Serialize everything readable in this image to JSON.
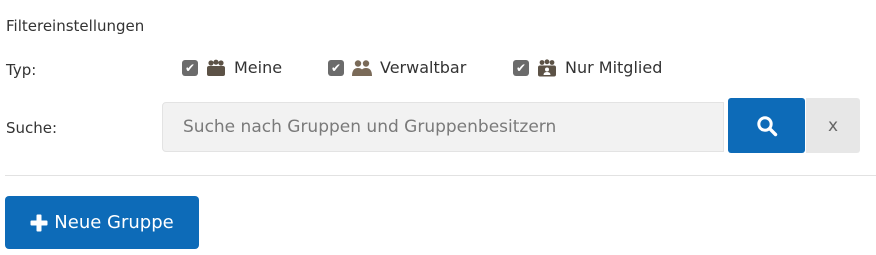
{
  "filter": {
    "heading": "Filtereinstellungen",
    "type_label": "Typ:",
    "checkboxes": [
      {
        "label": "Meine",
        "checked": true,
        "icon": "group-owner-icon"
      },
      {
        "label": "Verwaltbar",
        "checked": true,
        "icon": "users-icon"
      },
      {
        "label": "Nur Mitglied",
        "checked": true,
        "icon": "member-icon"
      }
    ],
    "search_label": "Suche:",
    "search_placeholder": "Suche nach Gruppen und Gruppenbesitzern",
    "search_value": "",
    "search_icon": "search-icon",
    "clear_label": "x"
  },
  "actions": {
    "new_group_label": "Neue Gruppe",
    "new_group_icon": "plus-icon"
  },
  "colors": {
    "primary": "#0d6bb8",
    "checkbox": "#6b6b6b",
    "icon": "#5c5246",
    "input_bg": "#f2f2f2",
    "clear_bg": "#e7e7e7"
  }
}
